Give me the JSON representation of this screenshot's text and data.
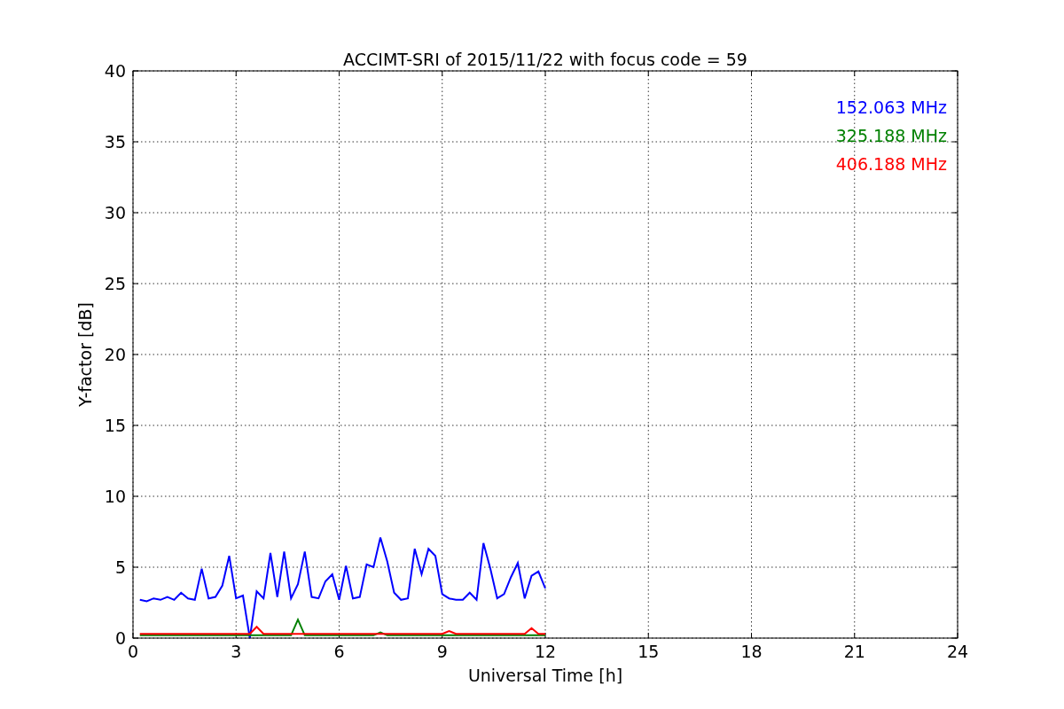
{
  "figure": {
    "chart_data": {
      "type": "line",
      "title": "ACCIMT-SRI of 2015/11/22 with focus code = 59",
      "xlabel": "Universal Time [h]",
      "ylabel": "Y-factor [dB]",
      "x": [
        0.2,
        0.4,
        0.6,
        0.8,
        1.0,
        1.2,
        1.4,
        1.6,
        1.8,
        2.0,
        2.2,
        2.4,
        2.6,
        2.8,
        3.0,
        3.2,
        3.4,
        3.6,
        3.8,
        4.0,
        4.2,
        4.4,
        4.6,
        4.8,
        5.0,
        5.2,
        5.4,
        5.6,
        5.8,
        6.0,
        6.2,
        6.4,
        6.6,
        6.8,
        7.0,
        7.2,
        7.4,
        7.6,
        7.8,
        8.0,
        8.2,
        8.4,
        8.6,
        8.8,
        9.0,
        9.2,
        9.4,
        9.6,
        9.8,
        10.0,
        10.2,
        10.4,
        10.6,
        10.8,
        11.0,
        11.2,
        11.4,
        11.6,
        11.8,
        12.0
      ],
      "series": [
        {
          "name": "152.063 MHz",
          "color": "#0000ff",
          "values": [
            2.7,
            2.6,
            2.8,
            2.7,
            2.9,
            2.7,
            3.2,
            2.8,
            2.7,
            4.9,
            2.8,
            2.9,
            3.7,
            5.8,
            2.8,
            3.0,
            0.0,
            3.3,
            2.8,
            6.0,
            2.9,
            6.1,
            2.8,
            3.8,
            6.1,
            2.9,
            2.8,
            4.0,
            4.5,
            2.7,
            5.1,
            2.8,
            2.9,
            5.2,
            5.0,
            7.1,
            5.4,
            3.2,
            2.7,
            2.8,
            6.3,
            4.5,
            6.3,
            5.8,
            3.1,
            2.8,
            2.7,
            2.7,
            3.2,
            2.7,
            6.7,
            4.9,
            2.8,
            3.1,
            4.3,
            5.3,
            2.8,
            4.4,
            4.7,
            3.5
          ]
        },
        {
          "name": "325.188 MHz",
          "color": "#008000",
          "values": [
            0.2,
            0.2,
            0.2,
            0.2,
            0.2,
            0.2,
            0.2,
            0.2,
            0.2,
            0.2,
            0.2,
            0.2,
            0.2,
            0.2,
            0.2,
            0.2,
            0.2,
            0.2,
            0.2,
            0.2,
            0.2,
            0.2,
            0.2,
            1.3,
            0.2,
            0.2,
            0.2,
            0.2,
            0.2,
            0.2,
            0.2,
            0.2,
            0.2,
            0.2,
            0.2,
            0.4,
            0.2,
            0.2,
            0.2,
            0.2,
            0.2,
            0.2,
            0.2,
            0.2,
            0.2,
            0.2,
            0.2,
            0.2,
            0.2,
            0.2,
            0.2,
            0.2,
            0.2,
            0.2,
            0.2,
            0.2,
            0.2,
            0.2,
            0.2,
            0.2
          ]
        },
        {
          "name": "406.188 MHz",
          "color": "#ff0000",
          "values": [
            0.3,
            0.3,
            0.3,
            0.3,
            0.3,
            0.3,
            0.3,
            0.3,
            0.3,
            0.3,
            0.3,
            0.3,
            0.3,
            0.3,
            0.3,
            0.3,
            0.3,
            0.8,
            0.3,
            0.3,
            0.3,
            0.3,
            0.3,
            0.3,
            0.3,
            0.3,
            0.3,
            0.3,
            0.3,
            0.3,
            0.3,
            0.3,
            0.3,
            0.3,
            0.3,
            0.3,
            0.3,
            0.3,
            0.3,
            0.3,
            0.3,
            0.3,
            0.3,
            0.3,
            0.3,
            0.5,
            0.3,
            0.3,
            0.3,
            0.3,
            0.3,
            0.3,
            0.3,
            0.3,
            0.3,
            0.3,
            0.3,
            0.7,
            0.3,
            0.3
          ]
        }
      ],
      "grid": true,
      "xlim": [
        0,
        24
      ],
      "ylim": [
        0,
        40
      ],
      "xticks": [
        0,
        3,
        6,
        9,
        12,
        15,
        18,
        21,
        24
      ],
      "yticks": [
        0,
        5,
        10,
        15,
        20,
        25,
        30,
        35,
        40
      ]
    }
  }
}
